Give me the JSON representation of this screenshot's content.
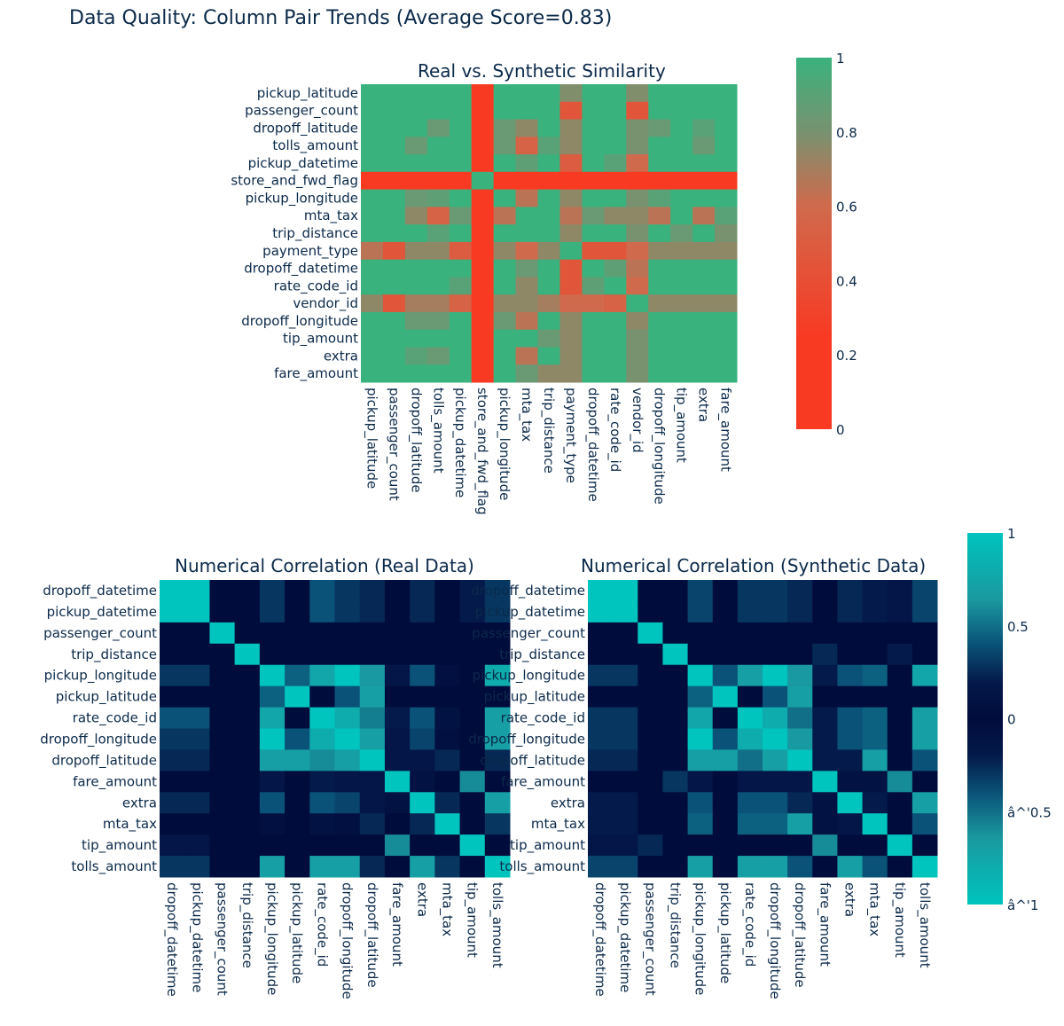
{
  "main_title": "Data Quality: Column Pair Trends (Average Score=0.83)",
  "chart_data": [
    {
      "type": "heatmap",
      "id": "similarity",
      "title": "Real vs. Synthetic Similarity",
      "x_labels": [
        "pickup_latitude",
        "passenger_count",
        "dropoff_latitude",
        "tolls_amount",
        "pickup_datetime",
        "store_and_fwd_flag",
        "pickup_longitude",
        "mta_tax",
        "trip_distance",
        "payment_type",
        "dropoff_datetime",
        "rate_code_id",
        "vendor_id",
        "dropoff_longitude",
        "tip_amount",
        "extra",
        "fare_amount"
      ],
      "y_labels": [
        "pickup_latitude",
        "passenger_count",
        "dropoff_latitude",
        "tolls_amount",
        "pickup_datetime",
        "store_and_fwd_flag",
        "pickup_longitude",
        "mta_tax",
        "trip_distance",
        "payment_type",
        "dropoff_datetime",
        "rate_code_id",
        "vendor_id",
        "dropoff_longitude",
        "tip_amount",
        "extra",
        "fare_amount"
      ],
      "zrange": [
        0,
        1
      ],
      "colorscale": [
        [
          0,
          "#F83A23"
        ],
        [
          0.25,
          "#F83A23"
        ],
        [
          0.6,
          "#D06A4C"
        ],
        [
          0.8,
          "#789270"
        ],
        [
          1,
          "#3AB27D"
        ]
      ],
      "colorbar_ticks": [
        "0",
        "0.2",
        "0.4",
        "0.6",
        "0.8",
        "1"
      ],
      "colorbar_tick_values": [
        0,
        0.2,
        0.4,
        0.6,
        0.8,
        1
      ],
      "z": [
        [
          1,
          1,
          1,
          1,
          1,
          0,
          1,
          1,
          1,
          0.78,
          1,
          1,
          0.78,
          1,
          1,
          1,
          1
        ],
        [
          1,
          1,
          1,
          1,
          1,
          0,
          1,
          1,
          1,
          0.45,
          1,
          1,
          0.45,
          1,
          1,
          1,
          1
        ],
        [
          1,
          1,
          1,
          0.85,
          1,
          0,
          0.85,
          0.75,
          1,
          0.75,
          1,
          1,
          0.8,
          0.85,
          1,
          0.9,
          1
        ],
        [
          1,
          1,
          0.85,
          1,
          1,
          0,
          0.85,
          0.55,
          0.9,
          0.75,
          1,
          1,
          0.8,
          1,
          1,
          0.85,
          1
        ],
        [
          1,
          1,
          1,
          1,
          1,
          0,
          1,
          0.88,
          1,
          0.5,
          1,
          0.9,
          0.6,
          1,
          1,
          1,
          1
        ],
        [
          0,
          0,
          0,
          0,
          0,
          1,
          0,
          0,
          0,
          0,
          0,
          0,
          0,
          0,
          0,
          0,
          0
        ],
        [
          1,
          1,
          0.85,
          0.88,
          1,
          0,
          1,
          0.65,
          1,
          0.75,
          1,
          1,
          0.8,
          0.9,
          1,
          1,
          1
        ],
        [
          1,
          1,
          0.75,
          0.55,
          0.85,
          0,
          0.65,
          1,
          1,
          0.65,
          0.85,
          0.75,
          0.75,
          0.65,
          1,
          0.65,
          0.9
        ],
        [
          1,
          1,
          1,
          0.9,
          1,
          0,
          1,
          1,
          1,
          0.75,
          1,
          1,
          0.8,
          1,
          0.85,
          1,
          0.8
        ],
        [
          0.65,
          0.45,
          0.75,
          0.75,
          0.5,
          0,
          0.75,
          0.6,
          0.75,
          1,
          0.45,
          0.45,
          0.6,
          0.75,
          0.75,
          0.75,
          0.75
        ],
        [
          1,
          1,
          1,
          1,
          1,
          0,
          1,
          0.85,
          1,
          0.45,
          1,
          0.88,
          0.65,
          1,
          1,
          1,
          1
        ],
        [
          1,
          1,
          1,
          1,
          0.9,
          0,
          1,
          0.75,
          1,
          0.45,
          0.88,
          1,
          0.6,
          1,
          1,
          1,
          1
        ],
        [
          0.75,
          0.45,
          0.7,
          0.7,
          0.55,
          0,
          0.75,
          0.75,
          0.7,
          0.6,
          0.6,
          0.55,
          1,
          0.75,
          0.75,
          0.75,
          0.75
        ],
        [
          1,
          1,
          0.85,
          0.85,
          1,
          0,
          0.85,
          0.65,
          1,
          0.75,
          1,
          1,
          0.75,
          1,
          1,
          1,
          1
        ],
        [
          1,
          1,
          1,
          1,
          1,
          0,
          1,
          1,
          0.85,
          0.75,
          1,
          1,
          0.8,
          1,
          1,
          1,
          1
        ],
        [
          1,
          1,
          0.9,
          0.85,
          1,
          0,
          1,
          0.65,
          1,
          0.75,
          1,
          1,
          0.8,
          1,
          1,
          1,
          1
        ],
        [
          1,
          1,
          1,
          1,
          1,
          0,
          1,
          0.85,
          0.75,
          0.75,
          1,
          1,
          0.8,
          1,
          1,
          1,
          1
        ]
      ]
    },
    {
      "type": "heatmap",
      "id": "corr_real",
      "title": "Numerical Correlation (Real Data)",
      "x_labels": [
        "dropoff_datetime",
        "pickup_datetime",
        "passenger_count",
        "trip_distance",
        "pickup_longitude",
        "pickup_latitude",
        "rate_code_id",
        "dropoff_longitude",
        "dropoff_latitude",
        "fare_amount",
        "extra",
        "mta_tax",
        "tip_amount",
        "tolls_amount"
      ],
      "y_labels": [
        "dropoff_datetime",
        "pickup_datetime",
        "passenger_count",
        "trip_distance",
        "pickup_longitude",
        "pickup_latitude",
        "rate_code_id",
        "dropoff_longitude",
        "dropoff_latitude",
        "fare_amount",
        "extra",
        "mta_tax",
        "tip_amount",
        "tolls_amount"
      ],
      "zrange": [
        -1,
        1
      ],
      "z": [
        [
          1,
          1,
          0,
          0,
          0.3,
          0,
          0.4,
          0.3,
          0.25,
          0,
          0.25,
          0,
          0.2,
          0.3
        ],
        [
          1,
          1,
          0,
          0,
          0.3,
          0,
          0.4,
          0.3,
          0.25,
          0,
          0.25,
          0,
          0.2,
          0.3
        ],
        [
          0,
          0,
          1,
          0,
          0,
          0,
          0,
          0,
          0,
          0,
          0,
          0,
          0,
          0
        ],
        [
          0,
          0,
          0,
          1,
          0,
          0,
          0,
          0,
          0,
          0,
          0,
          0,
          0,
          0
        ],
        [
          0.3,
          0.3,
          0,
          0,
          1,
          0.45,
          0.75,
          1,
          0.65,
          0.15,
          0.4,
          0.05,
          0,
          0.8
        ],
        [
          0,
          0,
          0,
          0,
          0.45,
          1,
          0,
          0.4,
          0.7,
          0,
          0,
          0,
          0,
          0
        ],
        [
          0.4,
          0.4,
          0,
          0,
          0.75,
          0,
          1,
          0.8,
          0.55,
          0.2,
          0.4,
          0.1,
          0,
          0.7
        ],
        [
          0.3,
          0.3,
          0,
          0,
          1,
          0.4,
          0.8,
          1,
          0.7,
          0.15,
          0.35,
          0.05,
          0,
          0.7
        ],
        [
          0.25,
          0.25,
          0,
          0,
          0.7,
          0.7,
          0.6,
          0.7,
          1,
          0.15,
          0.15,
          0.25,
          0,
          0.25
        ],
        [
          0,
          0,
          0,
          0,
          0.15,
          0,
          0.2,
          0.15,
          0.15,
          1,
          0.1,
          0,
          0.6,
          0
        ],
        [
          0.25,
          0.25,
          0,
          0,
          0.4,
          0,
          0.4,
          0.35,
          0.15,
          0.1,
          1,
          0.25,
          0,
          0.7
        ],
        [
          0,
          0,
          0,
          0,
          0.05,
          0,
          0.1,
          0.05,
          0.25,
          0,
          0.25,
          1,
          0,
          0.3
        ],
        [
          0.15,
          0.15,
          0,
          0,
          0,
          0,
          0,
          0,
          0,
          0.6,
          0,
          0,
          1,
          0
        ],
        [
          0.3,
          0.3,
          0,
          0,
          0.7,
          0,
          0.7,
          0.7,
          0.25,
          0,
          0.7,
          0.3,
          0,
          1
        ]
      ]
    },
    {
      "type": "heatmap",
      "id": "corr_synth",
      "title": "Numerical Correlation (Synthetic Data)",
      "x_labels": [
        "dropoff_datetime",
        "pickup_datetime",
        "passenger_count",
        "trip_distance",
        "pickup_longitude",
        "pickup_latitude",
        "rate_code_id",
        "dropoff_longitude",
        "dropoff_latitude",
        "fare_amount",
        "extra",
        "mta_tax",
        "tip_amount",
        "tolls_amount"
      ],
      "y_labels": [
        "dropoff_datetime",
        "pickup_datetime",
        "passenger_count",
        "trip_distance",
        "pickup_longitude",
        "pickup_latitude",
        "rate_code_id",
        "dropoff_longitude",
        "dropoff_latitude",
        "fare_amount",
        "extra",
        "mta_tax",
        "tip_amount",
        "tolls_amount"
      ],
      "zrange": [
        -1,
        1
      ],
      "colorbar_ticks": [
        "1",
        "0.5",
        "0",
        "â^'0.5",
        "â^'1"
      ],
      "colorbar_tick_values": [
        1,
        0.5,
        0,
        -0.5,
        -1
      ],
      "z": [
        [
          1,
          1,
          0,
          0,
          0.35,
          0,
          0.3,
          0.3,
          0.25,
          0,
          0.25,
          0.2,
          0.15,
          0.35
        ],
        [
          1,
          1,
          0,
          0,
          0.35,
          0,
          0.3,
          0.3,
          0.25,
          0,
          0.25,
          0.2,
          0.15,
          0.35
        ],
        [
          0,
          0,
          1,
          0,
          0,
          0,
          0,
          0,
          0,
          0,
          0,
          0,
          0,
          0
        ],
        [
          0,
          0,
          0,
          1,
          0,
          0,
          0,
          0,
          0,
          0.25,
          0,
          0,
          0.2,
          0
        ],
        [
          0.3,
          0.3,
          0,
          0,
          1,
          0.4,
          0.7,
          1,
          0.65,
          0.2,
          0.4,
          0.45,
          0,
          0.75
        ],
        [
          0,
          0,
          0,
          0,
          0.45,
          1,
          0,
          0.4,
          0.7,
          0,
          0,
          0,
          0,
          0
        ],
        [
          0.3,
          0.3,
          0,
          0,
          0.75,
          0,
          1,
          0.8,
          0.5,
          0.2,
          0.4,
          0.45,
          0,
          0.7
        ],
        [
          0.3,
          0.3,
          0,
          0,
          1,
          0.4,
          0.8,
          1,
          0.65,
          0.2,
          0.4,
          0.45,
          0,
          0.7
        ],
        [
          0.25,
          0.25,
          0,
          0,
          0.7,
          0.7,
          0.5,
          0.7,
          1,
          0.2,
          0.2,
          0.7,
          0,
          0.4
        ],
        [
          0,
          0,
          0,
          0.3,
          0.15,
          0,
          0.15,
          0.15,
          0.15,
          1,
          0.1,
          0.1,
          0.6,
          0
        ],
        [
          0.2,
          0.2,
          0,
          0,
          0.4,
          0,
          0.4,
          0.4,
          0.25,
          0.1,
          1,
          0.2,
          0,
          0.7
        ],
        [
          0.2,
          0.2,
          0,
          0,
          0.45,
          0,
          0.45,
          0.45,
          0.7,
          0.1,
          0.15,
          1,
          0,
          0.4
        ],
        [
          0.15,
          0.15,
          0.25,
          0,
          0,
          0,
          0,
          0,
          0,
          0.6,
          0,
          0,
          1,
          0
        ],
        [
          0.35,
          0.35,
          0,
          0,
          0.7,
          0,
          0.7,
          0.7,
          0.4,
          0,
          0.7,
          0.4,
          0,
          1
        ]
      ]
    }
  ]
}
